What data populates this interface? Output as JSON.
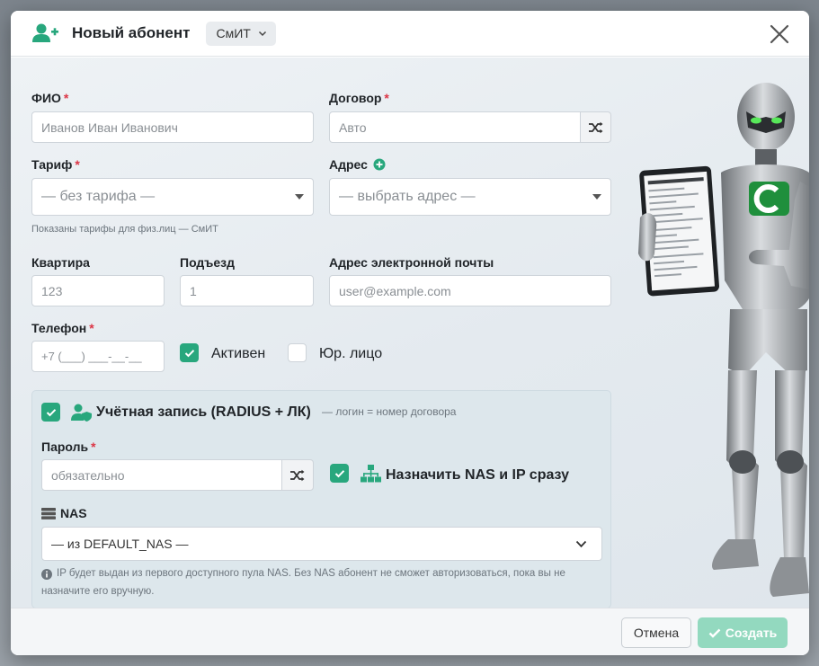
{
  "header": {
    "title": "Новый абонент",
    "org_select": "СмИТ"
  },
  "form": {
    "fio": {
      "label": "ФИО",
      "placeholder": "Иванов Иван Иванович"
    },
    "contract": {
      "label": "Договор",
      "placeholder": "Авто"
    },
    "tariff": {
      "label": "Тариф",
      "value": "— без тарифа —",
      "hint": "Показаны тарифы для физ.лиц — СмИТ"
    },
    "address": {
      "label": "Адрес",
      "value": "— выбрать адрес —"
    },
    "apartment": {
      "label": "Квартира",
      "placeholder": "123"
    },
    "entrance": {
      "label": "Подъезд",
      "placeholder": "1"
    },
    "email": {
      "label": "Адрес электронной почты",
      "placeholder": "user@example.com"
    },
    "phone": {
      "label": "Телефон",
      "placeholder": "+7 (___) ___-__-__"
    },
    "active": {
      "label": "Активен",
      "checked": true
    },
    "legal": {
      "label": "Юр. лицо",
      "checked": false
    },
    "required_mark": "*"
  },
  "account": {
    "title": "Учётная запись (RADIUS + ЛК)",
    "note": "— логин = номер договора",
    "enabled": true,
    "password": {
      "label": "Пароль",
      "placeholder": "обязательно"
    },
    "assign_nas": {
      "label": "Назначить NAS и IP сразу",
      "checked": true
    },
    "nas": {
      "label": "NAS",
      "value": "— из DEFAULT_NAS —"
    },
    "info_line1": "IP будет выдан из первого доступного пула NAS. Без NAS абонент не сможет авторизоваться, пока вы не",
    "info_line2": "назначите его вручную."
  },
  "footer": {
    "cancel": "Отмена",
    "create": "Создать"
  },
  "colors": {
    "accent": "#28a77d",
    "required": "#dc3545",
    "create_disabled": "#93d9bf"
  }
}
